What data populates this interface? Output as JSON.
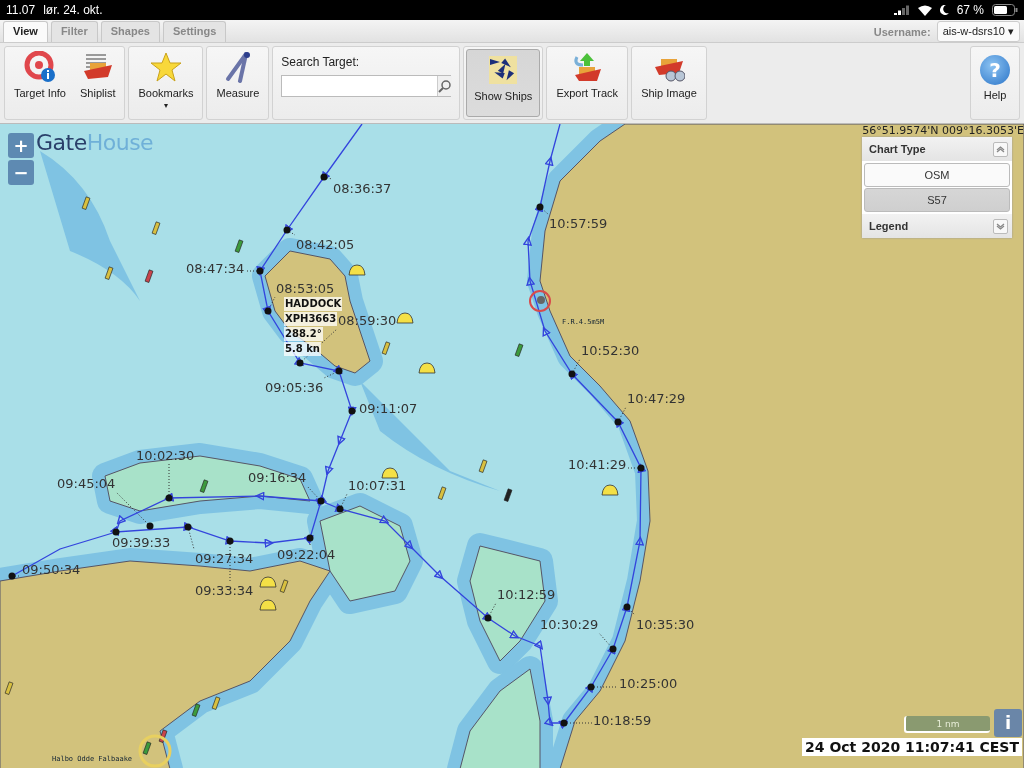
{
  "status_bar": {
    "time": "11.07",
    "date": "lør. 24. okt.",
    "battery": "67 %"
  },
  "tabs": [
    {
      "label": "View",
      "selected": true
    },
    {
      "label": "Filter",
      "selected": false
    },
    {
      "label": "Shapes",
      "selected": false
    },
    {
      "label": "Settings",
      "selected": false
    }
  ],
  "user": {
    "label": "Username:",
    "value": "ais-w-dsrs10",
    "caret": "▾"
  },
  "toolbar": [
    {
      "kind": "buttons",
      "items": [
        {
          "kind": "target",
          "label": "Target Info",
          "selected": false
        },
        {
          "kind": "shiplist",
          "label": "Shiplist",
          "selected": false
        }
      ]
    },
    {
      "kind": "buttons",
      "items": [
        {
          "kind": "bookmarks",
          "label": "Bookmarks",
          "caret": "▾",
          "selected": false
        }
      ]
    },
    {
      "kind": "buttons",
      "items": [
        {
          "kind": "measure",
          "label": "Measure",
          "selected": false
        }
      ]
    },
    {
      "kind": "search",
      "label": "Search Target:"
    },
    {
      "kind": "buttons",
      "items": [
        {
          "kind": "ships",
          "label": "Show Ships",
          "selected": true
        }
      ]
    },
    {
      "kind": "buttons",
      "items": [
        {
          "kind": "export",
          "label": "Export Track",
          "selected": false
        }
      ]
    },
    {
      "kind": "buttons",
      "items": [
        {
          "kind": "shipimage",
          "label": "Ship Image",
          "selected": false
        }
      ]
    }
  ],
  "help": {
    "label": "Help",
    "glyph": "?"
  },
  "map": {
    "logo": {
      "first": "Gate",
      "second": "House"
    },
    "zoom": [
      "+",
      "−"
    ],
    "coordinates": "56°51.9574'N 009°16.3053'E",
    "chart_type": {
      "title": "Chart Type",
      "expanded": true,
      "options": [
        {
          "label": "OSM",
          "selected": false
        },
        {
          "label": "S57",
          "selected": true
        }
      ]
    },
    "legend": {
      "title": "Legend",
      "expanded": false
    },
    "track_points": [
      {
        "time": "08:36:37"
      },
      {
        "time": "08:42:05"
      },
      {
        "time": "08:47:34"
      },
      {
        "time": "08:53:05"
      },
      {
        "time": "08:59:30"
      },
      {
        "time": "09:05:36"
      },
      {
        "time": "09:11:07"
      },
      {
        "time": "09:16:34"
      },
      {
        "time": "10:07:31"
      },
      {
        "time": "10:02:30"
      },
      {
        "time": "09:45:04"
      },
      {
        "time": "09:39:33"
      },
      {
        "time": "09:27:34"
      },
      {
        "time": "09:22:04"
      },
      {
        "time": "09:33:34"
      },
      {
        "time": "09:50:34"
      },
      {
        "time": "10:57:59"
      },
      {
        "time": "10:52:30"
      },
      {
        "time": "10:47:29"
      },
      {
        "time": "10:41:29"
      },
      {
        "time": "10:12:59"
      },
      {
        "time": "10:30:29"
      },
      {
        "time": "10:35:30"
      },
      {
        "time": "10:25:00"
      },
      {
        "time": "10:18:59"
      }
    ],
    "ship": {
      "name": "HADDOCK",
      "callsign": "XPH3663",
      "course": "288.2°",
      "speed": "5.8 kn"
    },
    "place_labels": [
      "F.R.4.5m5M",
      "Halbo Odde Falbaake"
    ],
    "scale": "1 nm",
    "info": "i",
    "timestamp": "24 Oct 2020 11:07:41 CEST"
  }
}
